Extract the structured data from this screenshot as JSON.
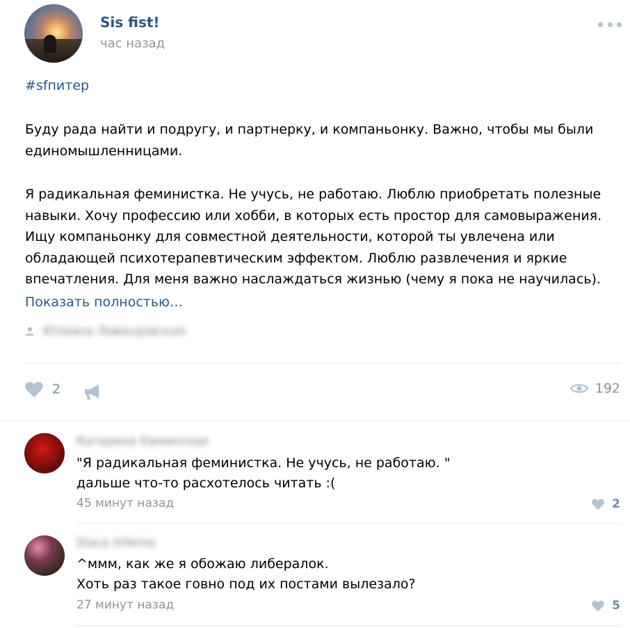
{
  "post": {
    "author": "Sis fist!",
    "time": "час назад",
    "hashtag": "#sfпитер",
    "paragraph1": "Буду рада найти и подругу, и партнерку, и компаньонку. Важно, чтобы мы были единомышленницами.",
    "paragraph2": "Я радикальная феминистка. Не учусь, не работаю. Люблю приобретать полезные навыки. Хочу профессию или хобби, в которых есть простор для самовыражения. Ищу компаньонку для совместной деятельности, которой ты увлечена или обладающей психотерапевтическим эффектом. Люблю развлечения и яркие впечатления. Для меня важно наслаждаться жизнью (чему я пока не научилась).",
    "show_more": "Показать полностью…",
    "signer": "Юлиана Левандовская",
    "likes": "2",
    "views": "192"
  },
  "comments": [
    {
      "author": "Катерина Каминская",
      "line1": "\"Я радикальная феминистка. Не учусь, не работаю. \"",
      "line2": "дальше что-то расхотелось читать :(",
      "time": "45 минут назад",
      "likes": "2"
    },
    {
      "author": "Stace Inferno",
      "line1": "^ммм, как же я обожаю либералок.",
      "line2": "Хоть раз такое говно под их постами вылезало?",
      "time": "27 минут назад",
      "likes": "5"
    }
  ],
  "colors": {
    "link": "#2a5885",
    "secondary": "#939393",
    "icon": "#b4c2d2",
    "divider": "#e7e8ec"
  },
  "icons": [
    "more-icon",
    "user-icon",
    "heart-icon",
    "share-icon",
    "eye-icon"
  ]
}
